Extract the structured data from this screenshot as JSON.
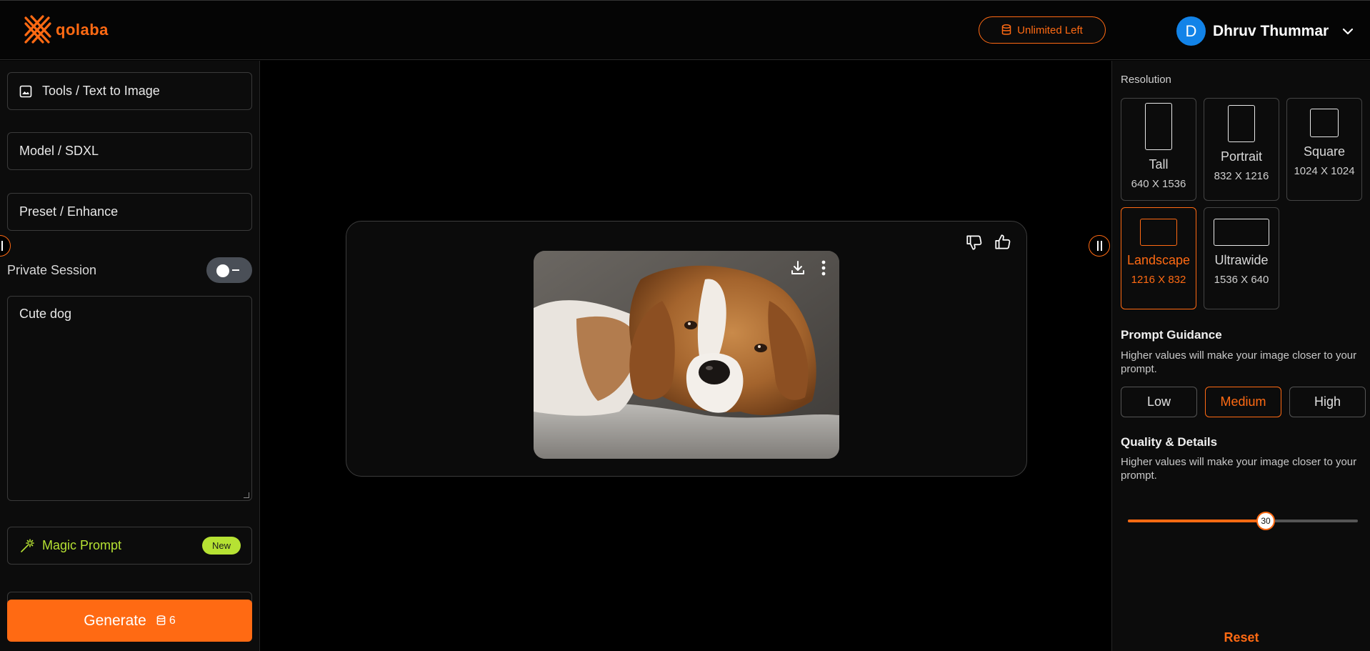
{
  "brand": {
    "name": "qolaba",
    "accent": "#ff6a13"
  },
  "header": {
    "credits_label": "Unlimited Left",
    "user": {
      "initial": "D",
      "name": "Dhruv Thummar"
    }
  },
  "left_panel": {
    "tool": "Tools / Text to Image",
    "model": "Model / SDXL",
    "preset": "Preset / Enhance",
    "private_session_label": "Private Session",
    "prompt_value": "Cute dog",
    "magic_prompt_label": "Magic Prompt",
    "new_badge": "New",
    "generate_label": "Generate",
    "generate_cost": "6"
  },
  "right_panel": {
    "resolution_label": "Resolution",
    "resolutions": [
      {
        "name": "Tall",
        "dims": "640 X 1536"
      },
      {
        "name": "Portrait",
        "dims": "832 X 1216"
      },
      {
        "name": "Square",
        "dims": "1024 X 1024"
      },
      {
        "name": "Landscape",
        "dims": "1216 X 832",
        "selected": true
      },
      {
        "name": "Ultrawide",
        "dims": "1536 X 640"
      }
    ],
    "prompt_guidance": {
      "title": "Prompt Guidance",
      "hint": "Higher values will make your image closer to your prompt.",
      "options": [
        "Low",
        "Medium",
        "High"
      ],
      "selected": "Medium"
    },
    "quality": {
      "title": "Quality & Details",
      "hint": "Higher values will make your image closer to your prompt.",
      "value": "30",
      "level_fraction": 0.6
    },
    "reset_label": "Reset"
  }
}
